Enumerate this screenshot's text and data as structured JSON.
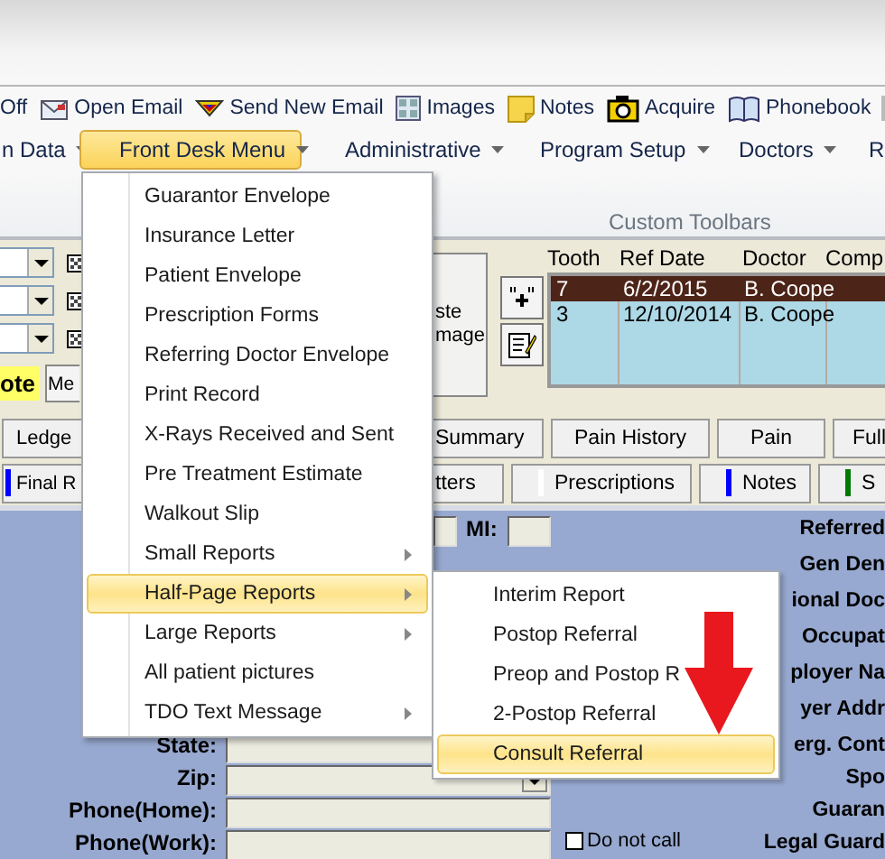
{
  "toolbar": [
    {
      "label": "Off",
      "kind": "none"
    },
    {
      "label": "Open Email",
      "kind": "open-email"
    },
    {
      "label": "Send New Email",
      "kind": "send-email"
    },
    {
      "label": "Images",
      "kind": "images"
    },
    {
      "label": "Notes",
      "kind": "notes"
    },
    {
      "label": "Acquire",
      "kind": "acquire"
    },
    {
      "label": "Phonebook",
      "kind": "phonebook"
    }
  ],
  "menu_bar": [
    {
      "label": "n Data",
      "dropdown": true,
      "selected": false
    },
    {
      "label": "Front Desk Menu",
      "dropdown": true,
      "selected": true
    },
    {
      "label": "Administrative",
      "dropdown": true,
      "selected": false
    },
    {
      "label": "Program Setup",
      "dropdown": true,
      "selected": false
    },
    {
      "label": "Doctors",
      "dropdown": true,
      "selected": false
    },
    {
      "label": "R",
      "dropdown": false,
      "selected": false
    }
  ],
  "ribbon_group": {
    "label": "Custom Toolbars"
  },
  "left_panel": {
    "note": "ote",
    "button": "Me"
  },
  "paste_button": {
    "label": "ste mage"
  },
  "table": {
    "columns": [
      "Tooth",
      "Ref Date",
      "Doctor",
      "Comp"
    ],
    "rows": [
      {
        "cells": [
          "7",
          "6/2/2015",
          "B. Coope"
        ],
        "selected": true
      },
      {
        "cells": [
          "3",
          "12/10/2014",
          "B. Coope"
        ],
        "selected": false
      }
    ]
  },
  "button_row_1": [
    {
      "label": "Ledge"
    },
    {
      "label": "Summary"
    },
    {
      "label": "Pain History"
    },
    {
      "label": "Pain"
    },
    {
      "label": "Full"
    }
  ],
  "button_row_2": [
    {
      "label": "Final R",
      "color": "#0000ff"
    },
    {
      "label": "tters"
    },
    {
      "label": "Prescriptions",
      "color": "#ffffff"
    },
    {
      "label": "Notes",
      "color": "#0000ff"
    },
    {
      "label": "S",
      "color": "#007a00"
    }
  ],
  "form": {
    "mi_label": "MI:",
    "left_labels": [
      "State:",
      "Zip:",
      "Phone(Home):",
      "Phone(Work):"
    ],
    "right_labels": [
      "Referred",
      "Gen Den",
      "ional Doc",
      "Occupat",
      "ployer Na",
      "yer Addr",
      "erg. Cont",
      "Spo",
      "Guaran",
      "Legal Guard"
    ],
    "do_not_call": {
      "label": "Do not call",
      "checked": false
    }
  },
  "front_desk_menu": [
    {
      "label": "Guarantor Envelope",
      "submenu": false,
      "selected": false
    },
    {
      "label": "Insurance Letter",
      "submenu": false,
      "selected": false
    },
    {
      "label": "Patient Envelope",
      "submenu": false,
      "selected": false
    },
    {
      "label": "Prescription Forms",
      "submenu": false,
      "selected": false
    },
    {
      "label": "Referring Doctor Envelope",
      "submenu": false,
      "selected": false
    },
    {
      "label": "Print Record",
      "submenu": false,
      "selected": false
    },
    {
      "label": "X-Rays Received and Sent",
      "submenu": false,
      "selected": false
    },
    {
      "label": "Pre Treatment Estimate",
      "submenu": false,
      "selected": false
    },
    {
      "label": "Walkout Slip",
      "submenu": false,
      "selected": false
    },
    {
      "label": "Small Reports",
      "submenu": true,
      "selected": false
    },
    {
      "label": "Half-Page Reports",
      "submenu": true,
      "selected": true
    },
    {
      "label": "Large Reports",
      "submenu": true,
      "selected": false
    },
    {
      "label": "All patient pictures",
      "submenu": false,
      "selected": false
    },
    {
      "label": "TDO Text Message",
      "submenu": true,
      "selected": false
    }
  ],
  "half_page_submenu": [
    {
      "label": "Interim Report",
      "selected": false
    },
    {
      "label": "Postop Referral",
      "selected": false
    },
    {
      "label": "Preop and Postop R",
      "selected": false
    },
    {
      "label": "2-Postop Referral",
      "selected": false
    },
    {
      "label": "Consult Referral",
      "selected": true
    }
  ]
}
